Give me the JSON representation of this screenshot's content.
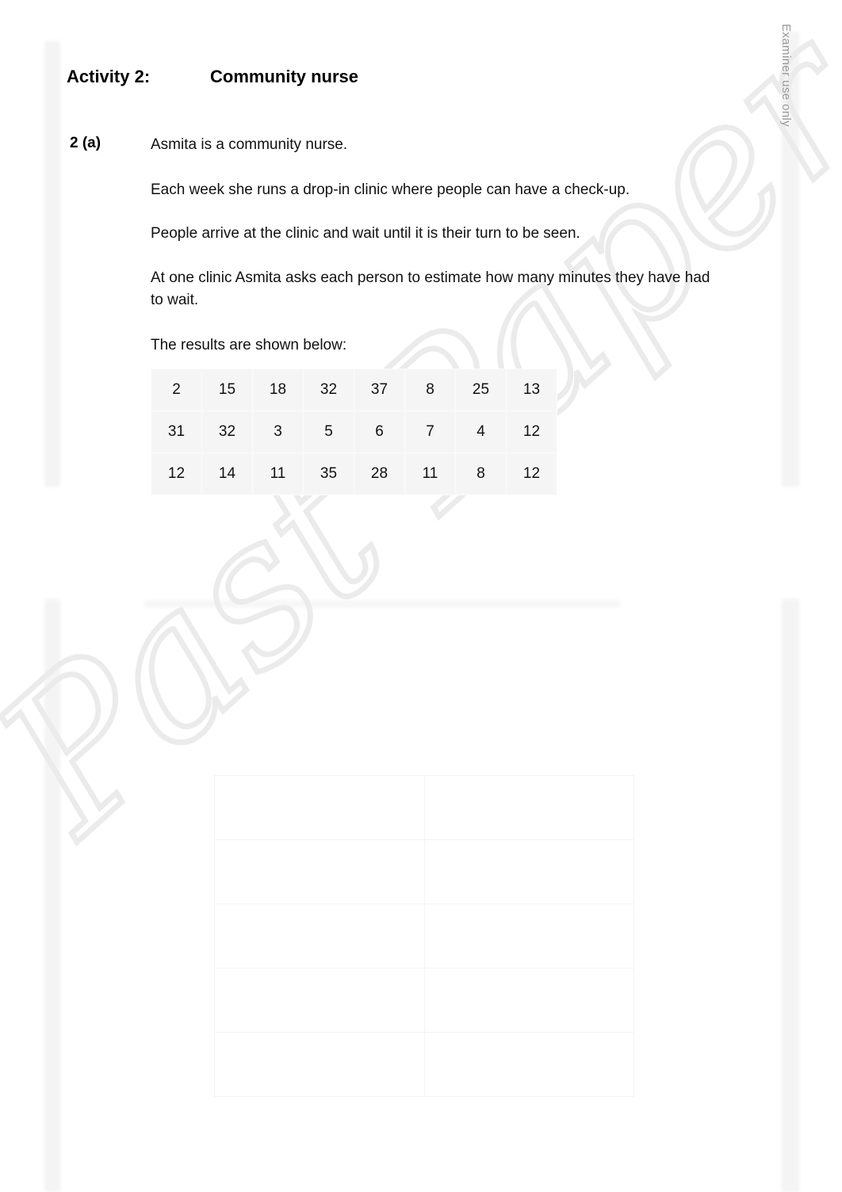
{
  "page": {
    "examiner_note": "Examiner use only",
    "watermark_text": "Past Paper"
  },
  "header": {
    "activity_label": "Activity 2:",
    "activity_title": "Community nurse"
  },
  "question": {
    "number": "2 (a)",
    "paragraphs": [
      "Asmita is a community nurse.",
      "Each week she runs a drop-in clinic where people can have a check-up.",
      "People arrive at the clinic and wait until it is their turn to be seen.",
      "At one clinic Asmita asks each person to estimate how many minutes they have had to wait.",
      "The results are shown below:"
    ]
  },
  "results_table": {
    "rows": [
      [
        "2",
        "15",
        "18",
        "32",
        "37",
        "8",
        "25",
        "13"
      ],
      [
        "31",
        "32",
        "3",
        "5",
        "6",
        "7",
        "4",
        "12"
      ],
      [
        "12",
        "14",
        "11",
        "35",
        "28",
        "11",
        "8",
        "12"
      ]
    ]
  },
  "answer_table": {
    "row_count": 5,
    "column_count": 2,
    "cells": [
      [
        "",
        ""
      ],
      [
        "",
        ""
      ],
      [
        "",
        ""
      ],
      [
        "",
        ""
      ],
      [
        "",
        ""
      ]
    ]
  }
}
